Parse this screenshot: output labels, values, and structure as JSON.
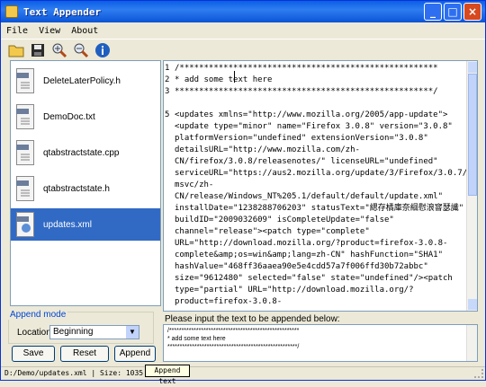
{
  "window": {
    "title": "Text Appender"
  },
  "menu": [
    "File",
    "View",
    "About"
  ],
  "toolbar": {
    "icons": [
      "folder-open-icon",
      "save-icon",
      "zoom-in-icon",
      "zoom-out-icon",
      "info-icon"
    ],
    "colors": {
      "folder": "#f2c94c",
      "save": "#2b2b2b",
      "info": "#1f5fbf"
    }
  },
  "files": [
    {
      "name": "DeleteLaterPolicy.h",
      "type": "doc"
    },
    {
      "name": "DemoDoc.txt",
      "type": "txt"
    },
    {
      "name": "qtabstractstate.cpp",
      "type": "doc"
    },
    {
      "name": "qtabstractstate.h",
      "type": "doc"
    },
    {
      "name": "updates.xml",
      "type": "xml",
      "selected": true
    }
  ],
  "editor": {
    "line_numbers": [
      "1",
      "2",
      "3",
      "5"
    ],
    "content": "/*****************************************************\n* add some text here\n*****************************************************/\n\n<updates xmlns=\"http://www.mozilla.org/2005/app-update\"><update type=\"minor\" name=\"Firefox 3.0.8\" version=\"3.0.8\" platformVersion=\"undefined\" extensionVersion=\"3.0.8\" detailsURL=\"http://www.mozilla.com/zh-CN/firefox/3.0.8/releasenotes/\" licenseURL=\"undefined\" serviceURL=\"https://aus2.mozilla.org/update/3/Firefox/3.0.7/2009021910/WINNT_x86-msvc/zh-CN/release/Windows_NT%205.1/default/default/update.xml\" installDate=\"1238288706203\" statusText=\"緦存橘庫奈絗慰浪窨瑟讖\" buildID=\"2009032609\" isCompleteUpdate=\"false\" channel=\"release\"><patch type=\"complete\" URL=\"http://download.mozilla.org/?product=firefox-3.0.8-complete&amp;os=win&amp;lang=zh-CN\" hashFunction=\"SHA1\" hashValue=\"468ff36aaea90e5e4cdd57a7f006ffd30b72abbc\" size=\"9612480\" selected=\"false\" state=\"undefined\"/><patch type=\"partial\" URL=\"http://download.mozilla.org/?product=firefox-3.0.8-"
  },
  "append_mode": {
    "group_label": "Append mode",
    "location_label": "Location:",
    "location_value": "Beginning"
  },
  "buttons": {
    "save": "Save",
    "reset": "Reset",
    "append": "Append"
  },
  "append_panel": {
    "label": "Please input the text to be appended below:",
    "text": "/*****************************************************\n* add some text here\n*****************************************************/"
  },
  "status": {
    "text": "D:/Demo/updates.xml | Size: 1035 Bytes"
  },
  "tooltip": "Append text"
}
